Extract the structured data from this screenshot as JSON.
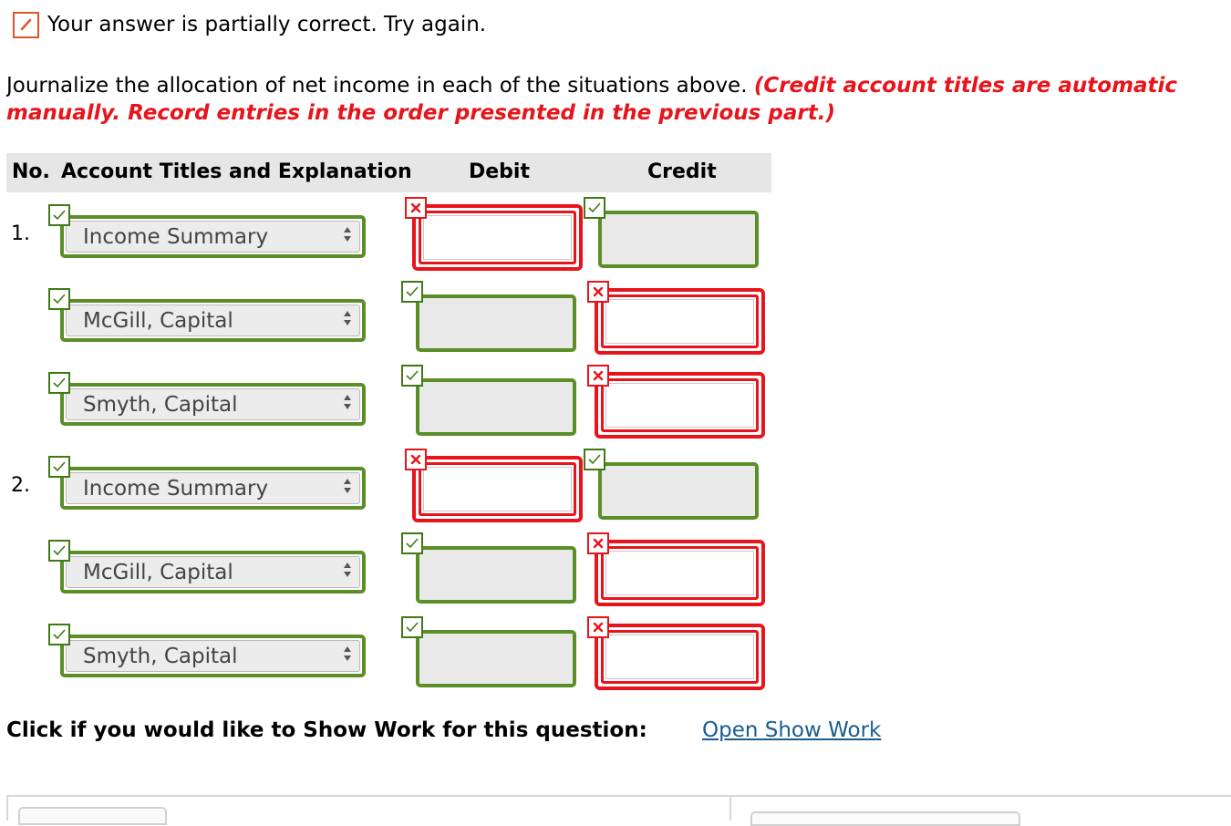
{
  "status": {
    "text": "Your answer is partially correct.  Try again.",
    "icon": "pencil-icon"
  },
  "instructions": {
    "line1_plain": "Journalize the allocation of net income in each of the situations above. ",
    "line1_red": "(Credit account titles are automatic",
    "line2_red": "manually. Record entries in the order presented in the previous part.)"
  },
  "table": {
    "headers": {
      "no": "No.",
      "account": "Account Titles and Explanation",
      "debit": "Debit",
      "credit": "Credit"
    }
  },
  "entries": [
    {
      "number": "1.",
      "rows": [
        {
          "account": "Income Summary",
          "account_status": "correct",
          "debit_status": "incorrect",
          "credit_status": "correct"
        },
        {
          "account": "McGill, Capital",
          "account_status": "correct",
          "debit_status": "correct",
          "credit_status": "incorrect"
        },
        {
          "account": "Smyth, Capital",
          "account_status": "correct",
          "debit_status": "correct",
          "credit_status": "incorrect"
        }
      ]
    },
    {
      "number": "2.",
      "rows": [
        {
          "account": "Income Summary",
          "account_status": "correct",
          "debit_status": "incorrect",
          "credit_status": "correct"
        },
        {
          "account": "McGill, Capital",
          "account_status": "correct",
          "debit_status": "correct",
          "credit_status": "incorrect"
        },
        {
          "account": "Smyth, Capital",
          "account_status": "correct",
          "debit_status": "correct",
          "credit_status": "incorrect"
        }
      ]
    }
  ],
  "show_work": {
    "prompt": "Click if you would like to Show Work for this question:",
    "link": "Open Show Work"
  },
  "colors": {
    "correct": "#5a8f28",
    "incorrect": "#e8141b",
    "link": "#1a5c8f",
    "partial": "#e0542a"
  }
}
